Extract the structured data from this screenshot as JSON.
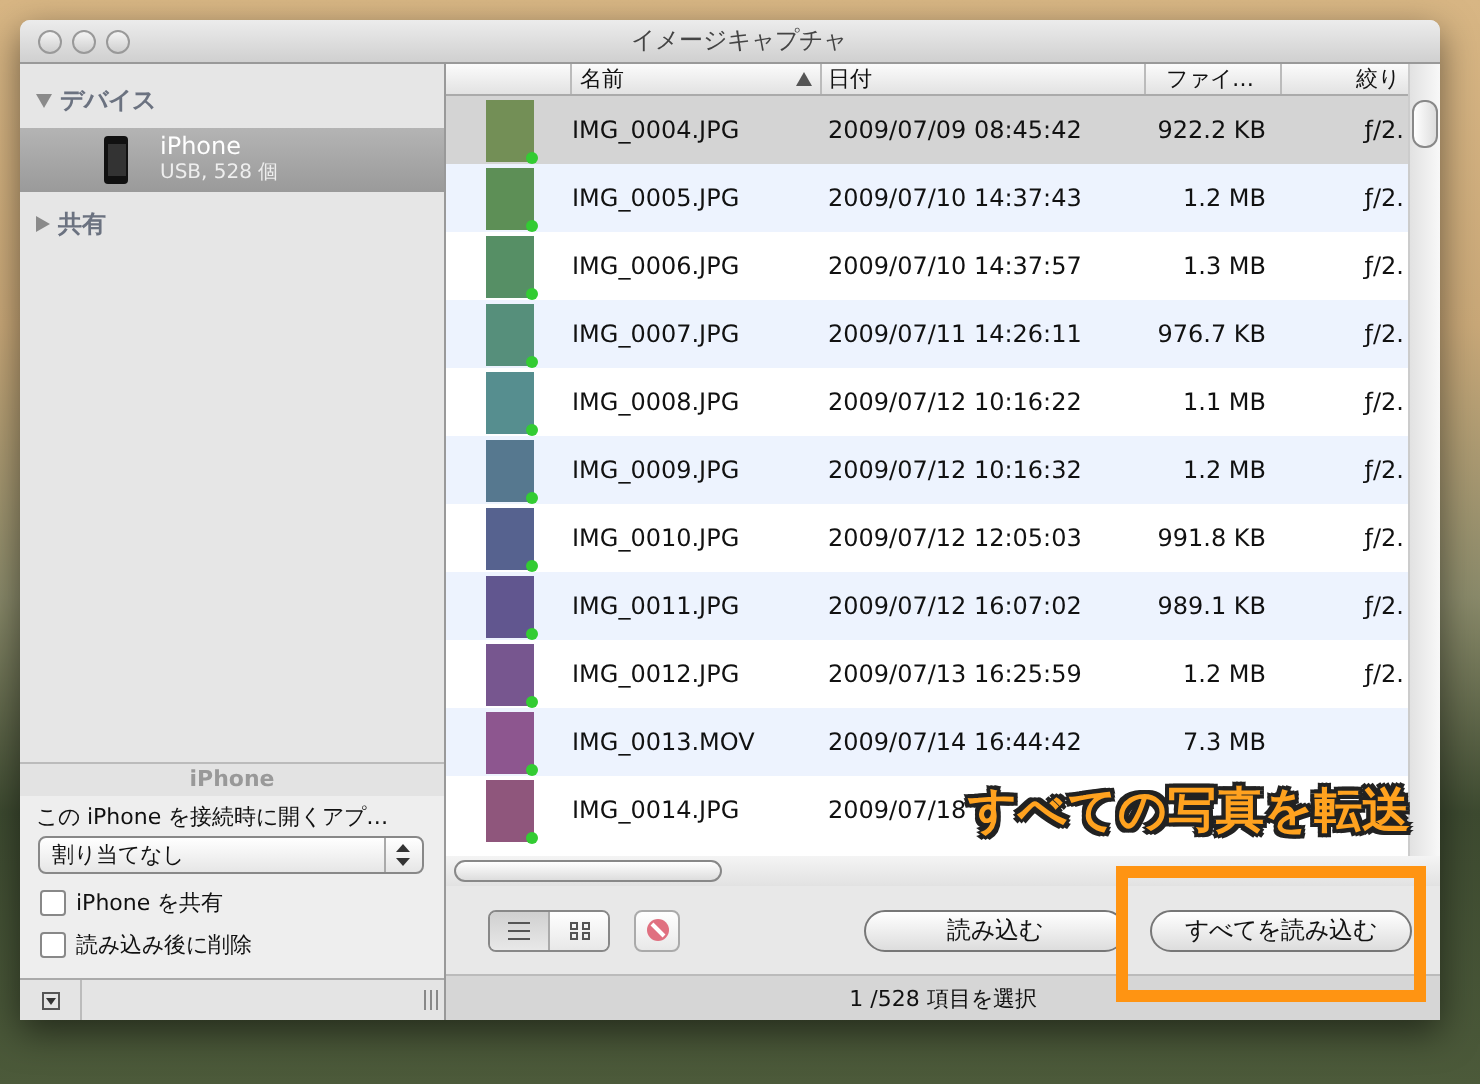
{
  "window": {
    "title": "イメージキャプチャ"
  },
  "sidebar": {
    "sections": [
      {
        "label": "デバイス",
        "expanded": true,
        "items": [
          {
            "name": "iPhone",
            "detail": "USB, 528 個",
            "selected": true
          }
        ]
      },
      {
        "label": "共有",
        "expanded": false
      }
    ],
    "device_panel": {
      "title": "iPhone",
      "open_app_label": "この iPhone を接続時に開くアプ…",
      "open_app_value": "割り当てなし",
      "options": [
        {
          "label": "iPhone を共有",
          "checked": false
        },
        {
          "label": "読み込み後に削除",
          "checked": false
        }
      ]
    }
  },
  "table": {
    "columns": [
      {
        "label": "名前",
        "sorted": true
      },
      {
        "label": "日付",
        "sorted": false
      },
      {
        "label": "ファイ…",
        "sorted": false
      },
      {
        "label": "絞り",
        "sorted": false
      }
    ],
    "rows": [
      {
        "name": "IMG_0004.JPG",
        "date": "2009/07/09 08:45:42",
        "size": "922.2 KB",
        "aperture": "ƒ/2.",
        "selected": true,
        "imported": true
      },
      {
        "name": "IMG_0005.JPG",
        "date": "2009/07/10 14:37:43",
        "size": "1.2 MB",
        "aperture": "ƒ/2.",
        "selected": false,
        "imported": true
      },
      {
        "name": "IMG_0006.JPG",
        "date": "2009/07/10 14:37:57",
        "size": "1.3 MB",
        "aperture": "ƒ/2.",
        "selected": false,
        "imported": true
      },
      {
        "name": "IMG_0007.JPG",
        "date": "2009/07/11 14:26:11",
        "size": "976.7 KB",
        "aperture": "ƒ/2.",
        "selected": false,
        "imported": true
      },
      {
        "name": "IMG_0008.JPG",
        "date": "2009/07/12 10:16:22",
        "size": "1.1 MB",
        "aperture": "ƒ/2.",
        "selected": false,
        "imported": true
      },
      {
        "name": "IMG_0009.JPG",
        "date": "2009/07/12 10:16:32",
        "size": "1.2 MB",
        "aperture": "ƒ/2.",
        "selected": false,
        "imported": true
      },
      {
        "name": "IMG_0010.JPG",
        "date": "2009/07/12 12:05:03",
        "size": "991.8 KB",
        "aperture": "ƒ/2.",
        "selected": false,
        "imported": true
      },
      {
        "name": "IMG_0011.JPG",
        "date": "2009/07/12 16:07:02",
        "size": "989.1 KB",
        "aperture": "ƒ/2.",
        "selected": false,
        "imported": true
      },
      {
        "name": "IMG_0012.JPG",
        "date": "2009/07/13 16:25:59",
        "size": "1.2 MB",
        "aperture": "ƒ/2.",
        "selected": false,
        "imported": true
      },
      {
        "name": "IMG_0013.MOV",
        "date": "2009/07/14 16:44:42",
        "size": "7.3 MB",
        "selected": false,
        "imported": true
      },
      {
        "name": "IMG_0014.JPG",
        "date": "2009/07/18",
        "selected": false,
        "imported": true
      }
    ]
  },
  "toolbar": {
    "view_modes": [
      {
        "kind": "list",
        "selected": true
      },
      {
        "kind": "grid",
        "selected": false
      }
    ],
    "buttons": [
      "読み込む",
      "すべてを読み込む"
    ]
  },
  "status_bar": {
    "text": "1 /528 項目を選択"
  },
  "annotation": {
    "text": "すべての写真を転送",
    "highlight_box": true
  }
}
